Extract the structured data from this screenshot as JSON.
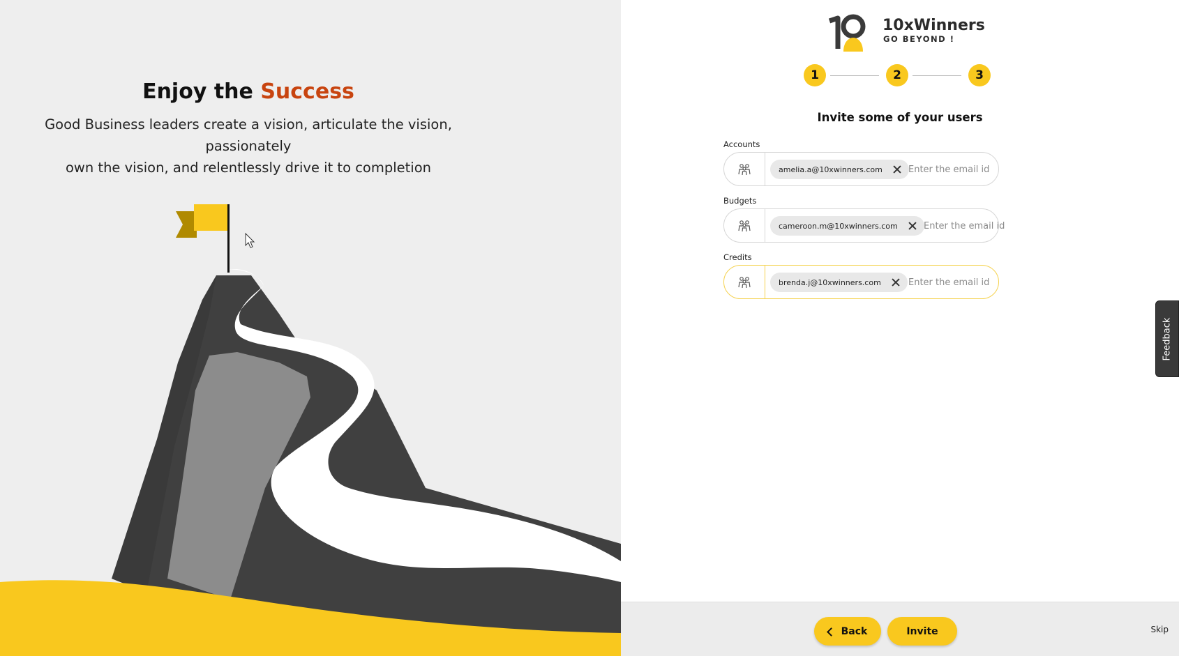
{
  "hero": {
    "title_prefix": "Enjoy the ",
    "title_accent": "Success",
    "subtitle_line1": "Good Business leaders create a vision, articulate the vision, passionately",
    "subtitle_line2": "own the vision, and relentlessly drive it to completion"
  },
  "brand": {
    "name": "10xWinners",
    "tagline": "GO BEYOND !"
  },
  "stepper": {
    "steps": [
      "1",
      "2",
      "3"
    ]
  },
  "form": {
    "title": "Invite some of your users",
    "fields": [
      {
        "label": "Accounts",
        "chip": "amelia.a@10xwinners.com",
        "placeholder": "Enter the email id"
      },
      {
        "label": "Budgets",
        "chip": "cameroon.m@10xwinners.com",
        "placeholder": "Enter the email id"
      },
      {
        "label": "Credits",
        "chip": "brenda.j@10xwinners.com",
        "placeholder": "Enter the email id"
      }
    ]
  },
  "footer": {
    "back_label": "Back",
    "invite_label": "Invite",
    "skip_label": "Skip"
  },
  "feedback_label": "Feedback",
  "colors": {
    "accent": "#f9c81e",
    "success_text": "#c8440f",
    "mountain_dark": "#404040",
    "mountain_mid": "#8c8c8c"
  }
}
